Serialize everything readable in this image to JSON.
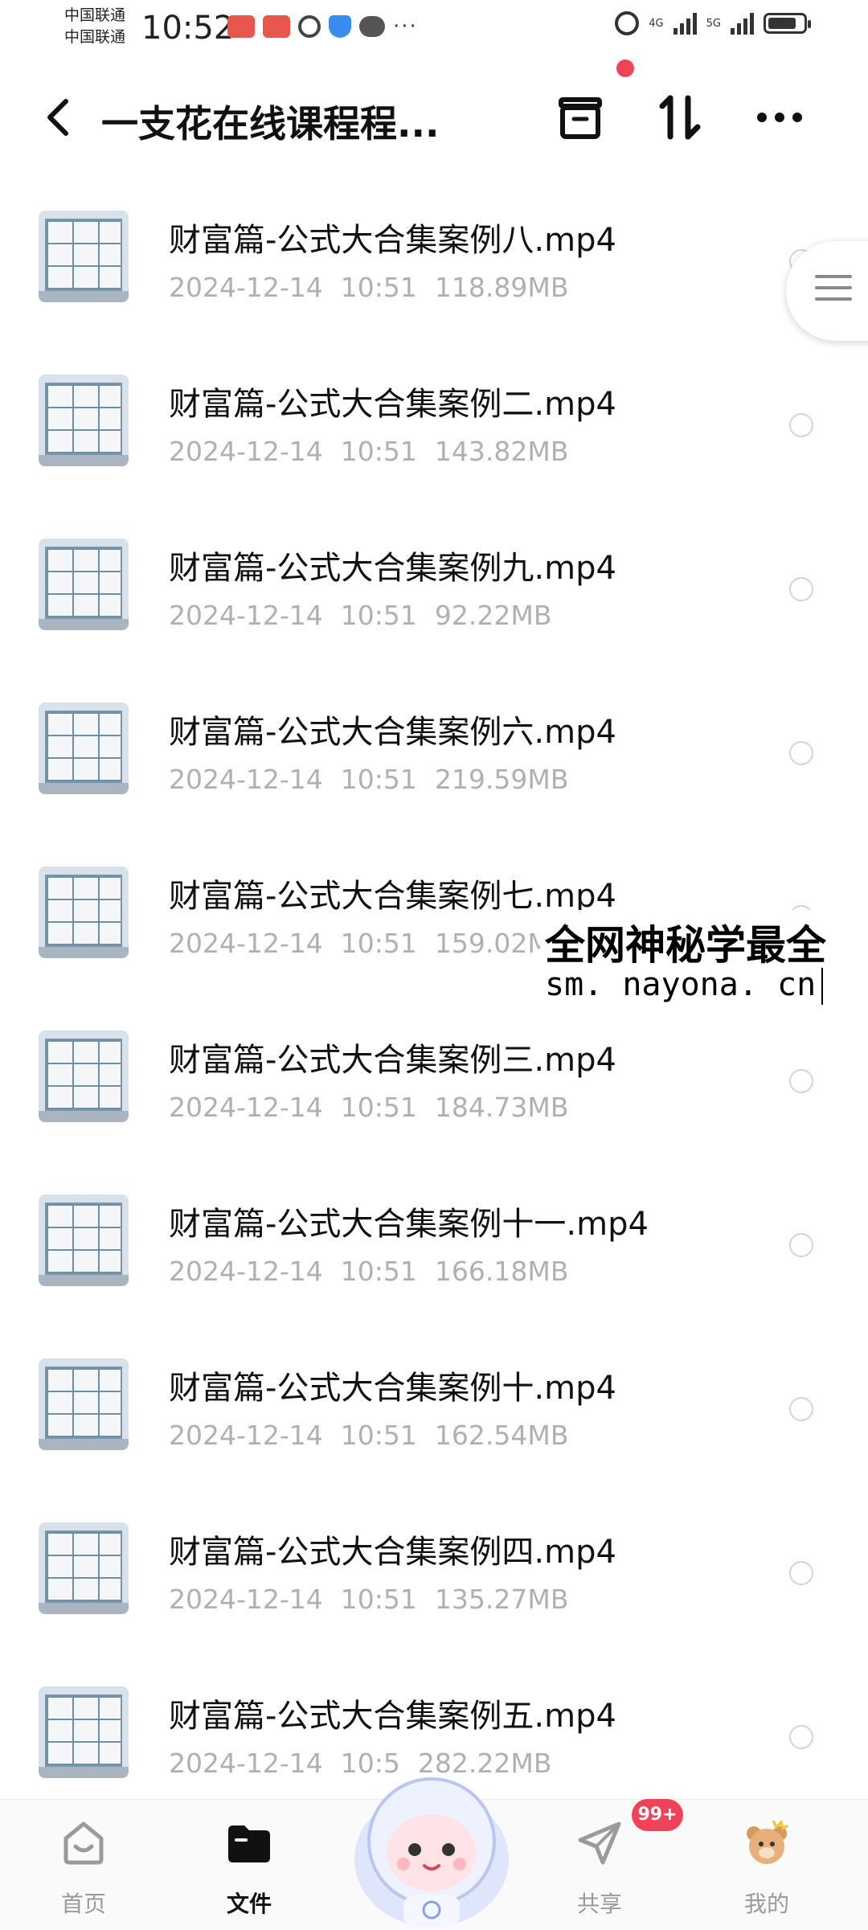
{
  "status_bar": {
    "carrier_1": "中国联通",
    "carrier_2": "中国联通",
    "time": "10:52",
    "net_1": "4G",
    "net_2": "5G"
  },
  "header": {
    "title": "一支花在线课程程...",
    "back_icon": "chevron-left-icon",
    "actions": [
      "archive-box-icon",
      "sort-icon",
      "more-icon"
    ]
  },
  "files": [
    {
      "name": "财富篇-公式大合集案例八.mp4",
      "date": "2024-12-14",
      "time": "10:51",
      "size": "118.89MB"
    },
    {
      "name": "财富篇-公式大合集案例二.mp4",
      "date": "2024-12-14",
      "time": "10:51",
      "size": "143.82MB"
    },
    {
      "name": "财富篇-公式大合集案例九.mp4",
      "date": "2024-12-14",
      "time": "10:51",
      "size": "92.22MB"
    },
    {
      "name": "财富篇-公式大合集案例六.mp4",
      "date": "2024-12-14",
      "time": "10:51",
      "size": "219.59MB"
    },
    {
      "name": "财富篇-公式大合集案例七.mp4",
      "date": "2024-12-14",
      "time": "10:51",
      "size": "159.02M"
    },
    {
      "name": "财富篇-公式大合集案例三.mp4",
      "date": "2024-12-14",
      "time": "10:51",
      "size": "184.73MB"
    },
    {
      "name": "财富篇-公式大合集案例十一.mp4",
      "date": "2024-12-14",
      "time": "10:51",
      "size": "166.18MB"
    },
    {
      "name": "财富篇-公式大合集案例十.mp4",
      "date": "2024-12-14",
      "time": "10:51",
      "size": "162.54MB"
    },
    {
      "name": "财富篇-公式大合集案例四.mp4",
      "date": "2024-12-14",
      "time": "10:51",
      "size": "135.27MB"
    },
    {
      "name": "财富篇-公式大合集案例五.mp4",
      "date": "2024-12-14",
      "time": "10:5",
      "size": "282.22MB"
    }
  ],
  "watermark": {
    "line1": "全网神秘学最全",
    "line2": "sm. nayona. cn"
  },
  "bottom_nav": {
    "home": "首页",
    "files": "文件",
    "share": "共享",
    "mine": "我的",
    "share_badge": "99+"
  },
  "colors": {
    "accent_red": "#f0435a",
    "meta_gray": "#b0b0b0"
  }
}
